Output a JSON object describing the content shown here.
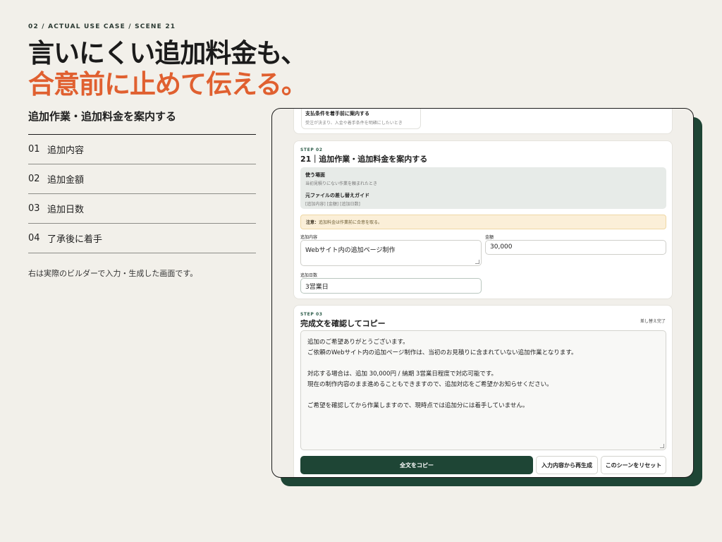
{
  "eyebrow": "02 / ACTUAL USE CASE / SCENE 21",
  "headline": {
    "line1": "言いにくい追加料金も、",
    "line2": "合意前に止めて伝える。"
  },
  "colors": {
    "accent": "#e06030",
    "brand_green": "#1e4535",
    "background": "#f2f0ea"
  },
  "left": {
    "subtitle": "追加作業・追加料金を案内する",
    "items": [
      {
        "num": "01",
        "label": "追加内容"
      },
      {
        "num": "02",
        "label": "追加金額"
      },
      {
        "num": "03",
        "label": "追加日数"
      },
      {
        "num": "04",
        "label": "了承後に着手"
      }
    ],
    "note": "右は実際のビルダーで入力・生成した画面です。"
  },
  "app": {
    "prev_card": {
      "title": "支払条件を着手前に案内する",
      "desc": "受注が決まり、入金や着手条件を明確にしたいとき"
    },
    "step2": {
      "step": "STEP 02",
      "title": "21｜追加作業・追加料金を案内する",
      "use_label": "使う場面",
      "use_text": "当初見積りにない作業を頼まれたとき",
      "guide_label": "元ファイルの差し替えガイド",
      "guide_text": "[追加内容] [金額] [追加日数]",
      "warn_label": "注意：",
      "warn_text": "追加料金は作業前に合意を取る。",
      "fields": {
        "content_label": "追加内容",
        "content_value": "Webサイト内の追加ページ制作",
        "amount_label": "金額",
        "amount_value": "30,000",
        "days_label": "追加日数",
        "days_value": "3営業日"
      }
    },
    "step3": {
      "step": "STEP 03",
      "title": "完成文を確認してコピー",
      "status": "差し替え完了",
      "output_lines": [
        "追加のご希望ありがとうございます。",
        "ご依頼のWebサイト内の追加ページ制作は、当初のお見積りに含まれていない追加作業となります。",
        "",
        "対応する場合は、追加 30,000円 / 納期 3営業日程度で対応可能です。",
        "現在の制作内容のまま進めることもできますので、追加対応をご希望かお知らせください。",
        "",
        "ご希望を確認してから作業しますので、現時点では追加分には着手していません。"
      ],
      "buttons": {
        "copy": "全文をコピー",
        "regenerate": "入力内容から再生成",
        "reset": "このシーンをリセット"
      }
    }
  }
}
